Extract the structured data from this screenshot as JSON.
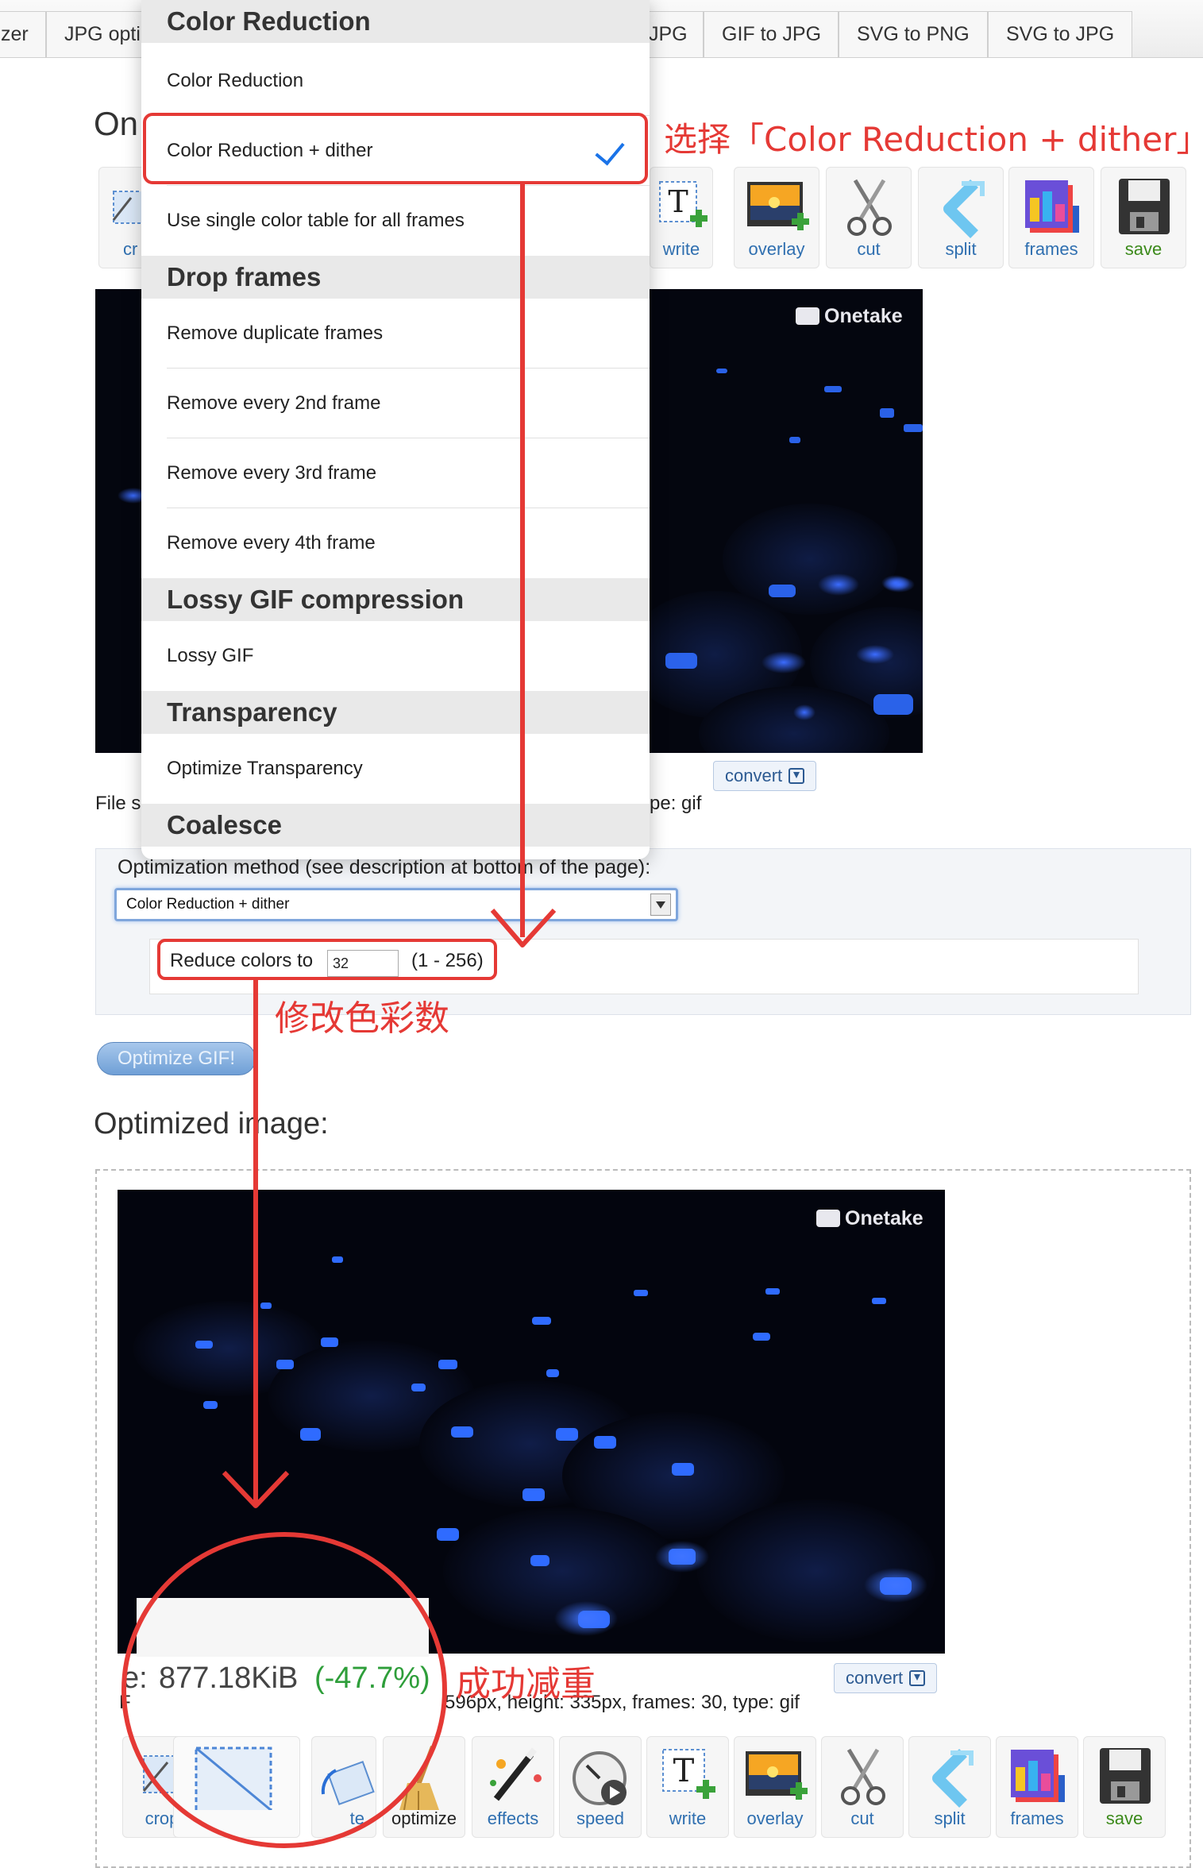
{
  "nav": {
    "tabs": [
      "zer",
      "JPG opti",
      "JPG",
      "GIF to JPG",
      "SVG to PNG",
      "SVG to JPG"
    ]
  },
  "page": {
    "heading_partial": "On",
    "file_info_left": "File s",
    "file_info_right": "pe: gif",
    "convert_label": "convert",
    "optimization_label": "Optimization method (see description at bottom of the page):",
    "selected_method": "Color Reduction + dither",
    "reduce_colors_label": "Reduce colors to",
    "reduce_colors_value": "32",
    "reduce_colors_range": "(1 - 256)",
    "optimize_button": "Optimize GIF!",
    "optimized_heading": "Optimized image:",
    "result_size_prefix": "e:",
    "result_size": "877.18KiB",
    "result_pct": "(-47.7%)",
    "result_info_left": "F",
    "result_info": "596px, height: 335px, frames: 30, type: gif",
    "brand": "Onetake"
  },
  "toolbar_top": [
    {
      "label": "cr",
      "icon": "crop-icon"
    },
    {
      "label": "write",
      "icon": "write-icon"
    },
    {
      "label": "overlay",
      "icon": "overlay-icon"
    },
    {
      "label": "cut",
      "icon": "cut-icon"
    },
    {
      "label": "split",
      "icon": "split-icon"
    },
    {
      "label": "frames",
      "icon": "frames-icon"
    },
    {
      "label": "save",
      "icon": "save-icon"
    }
  ],
  "toolbar_bottom": [
    {
      "label": "crop",
      "icon": "crop-icon"
    },
    {
      "label": "",
      "icon": "resize-icon"
    },
    {
      "label": "te",
      "icon": "rotate-icon"
    },
    {
      "label": "optimize",
      "icon": "optimize-icon"
    },
    {
      "label": "effects",
      "icon": "effects-icon"
    },
    {
      "label": "speed",
      "icon": "speed-icon"
    },
    {
      "label": "write",
      "icon": "write-icon"
    },
    {
      "label": "overlay",
      "icon": "overlay-icon"
    },
    {
      "label": "cut",
      "icon": "cut-icon"
    },
    {
      "label": "split",
      "icon": "split-icon"
    },
    {
      "label": "frames",
      "icon": "frames-icon"
    },
    {
      "label": "save",
      "icon": "save-icon"
    }
  ],
  "dropdown": {
    "groups": [
      {
        "title": "Color Reduction",
        "items": [
          "Color Reduction",
          "Color Reduction + dither",
          "Use single color table for all frames"
        ]
      },
      {
        "title": "Drop frames",
        "items": [
          "Remove duplicate frames",
          "Remove every 2nd frame",
          "Remove every 3rd frame",
          "Remove every 4th frame"
        ]
      },
      {
        "title": "Lossy GIF compression",
        "items": [
          "Lossy GIF"
        ]
      },
      {
        "title": "Transparency",
        "items": [
          "Optimize Transparency"
        ]
      },
      {
        "title": "Coalesce",
        "items": []
      }
    ],
    "selected": "Color Reduction + dither"
  },
  "annotations": {
    "select_note": "选择「Color Reduction + dither」",
    "colors_note": "修改色彩数",
    "success_note": "成功减重"
  },
  "colors": {
    "annotation_red": "#e53935",
    "link_blue": "#2f6fb0",
    "save_green": "#3c8a1b",
    "pct_green": "#2e9e3a",
    "check_blue": "#1a73e8"
  }
}
